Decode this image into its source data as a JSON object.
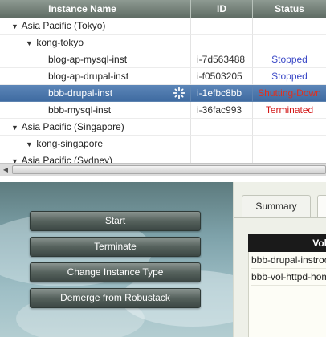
{
  "table": {
    "headers": {
      "name": "Instance Name",
      "id": "ID",
      "status": "Status"
    },
    "rows": [
      {
        "toggle": "▼",
        "name": "Asia Pacific (Tokyo)",
        "id": "",
        "status": ""
      },
      {
        "toggle": "▼",
        "name": "kong-tokyo",
        "id": "",
        "status": ""
      },
      {
        "toggle": "",
        "name": "blog-ap-mysql-inst",
        "id": "i-7d563488",
        "status": "Stopped"
      },
      {
        "toggle": "",
        "name": "blog-ap-drupal-inst",
        "id": "i-f0503205",
        "status": "Stopped"
      },
      {
        "toggle": "",
        "name": "bbb-drupal-inst",
        "id": "i-1efbc8bb",
        "status": "Shutting-Down"
      },
      {
        "toggle": "",
        "name": "bbb-mysql-inst",
        "id": "i-36fac993",
        "status": "Terminated"
      },
      {
        "toggle": "▼",
        "name": "Asia Pacific (Singapore)",
        "id": "",
        "status": ""
      },
      {
        "toggle": "▼",
        "name": "kong-singapore",
        "id": "",
        "status": ""
      },
      {
        "toggle": "▼",
        "name": "Asia Pacific (Sydney)",
        "id": "",
        "status": ""
      }
    ]
  },
  "actions": {
    "start": "Start",
    "terminate": "Terminate",
    "change_type": "Change Instance Type",
    "demerge": "Demerge from Robustack"
  },
  "detail": {
    "tab_summary": "Summary",
    "volumes_header": "Vol",
    "volumes": [
      "bbb-drupal-instroot",
      "bbb-vol-httpd-home"
    ]
  },
  "colors": {
    "stopped": "#3b49c7",
    "terminated": "#d21818",
    "selected_row": "#4a76ab",
    "header": "#6f7c74"
  },
  "icons": {
    "loading": "spinner-icon",
    "scroll_left": "arrow-left-icon"
  }
}
